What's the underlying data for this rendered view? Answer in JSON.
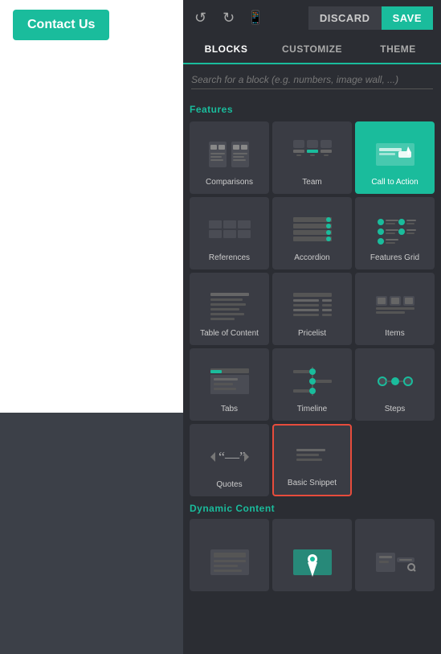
{
  "left_panel": {
    "button_label": "Contact Us"
  },
  "top_bar": {
    "discard_label": "DISCARD",
    "save_label": "SAVE"
  },
  "tabs": [
    {
      "id": "blocks",
      "label": "BLOCKS",
      "active": true
    },
    {
      "id": "customize",
      "label": "CUSTOMIZE",
      "active": false
    },
    {
      "id": "theme",
      "label": "THEME",
      "active": false
    }
  ],
  "search": {
    "placeholder": "Search for a block (e.g. numbers, image wall, ...)"
  },
  "sections": [
    {
      "label": "Features",
      "blocks": [
        {
          "id": "comparisons",
          "label": "Comparisons"
        },
        {
          "id": "team",
          "label": "Team"
        },
        {
          "id": "call-to-action",
          "label": "Call to Action"
        },
        {
          "id": "references",
          "label": "References"
        },
        {
          "id": "accordion",
          "label": "Accordion"
        },
        {
          "id": "features-grid",
          "label": "Features Grid"
        },
        {
          "id": "table-of-content",
          "label": "Table of Content"
        },
        {
          "id": "pricelist",
          "label": "Pricelist"
        },
        {
          "id": "items",
          "label": "Items"
        },
        {
          "id": "tabs",
          "label": "Tabs"
        },
        {
          "id": "timeline",
          "label": "Timeline"
        },
        {
          "id": "steps",
          "label": "Steps"
        },
        {
          "id": "quotes",
          "label": "Quotes"
        },
        {
          "id": "basic-snippet",
          "label": "Basic Snippet",
          "highlighted": true
        }
      ]
    },
    {
      "label": "Dynamic Content",
      "blocks": [
        {
          "id": "dynamic-1",
          "label": ""
        },
        {
          "id": "dynamic-2",
          "label": ""
        },
        {
          "id": "dynamic-3",
          "label": ""
        }
      ]
    }
  ]
}
